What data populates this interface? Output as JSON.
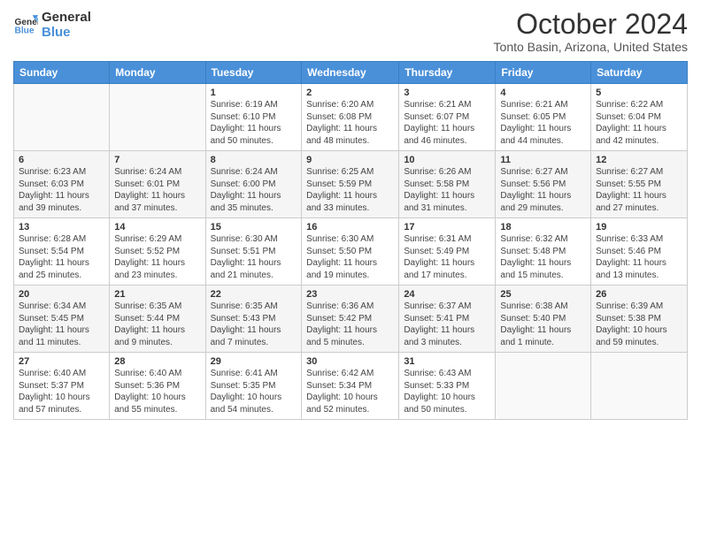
{
  "logo": {
    "line1": "General",
    "line2": "Blue"
  },
  "title": "October 2024",
  "subtitle": "Tonto Basin, Arizona, United States",
  "days_of_week": [
    "Sunday",
    "Monday",
    "Tuesday",
    "Wednesday",
    "Thursday",
    "Friday",
    "Saturday"
  ],
  "weeks": [
    [
      {
        "day": "",
        "info": ""
      },
      {
        "day": "",
        "info": ""
      },
      {
        "day": "1",
        "info": "Sunrise: 6:19 AM\nSunset: 6:10 PM\nDaylight: 11 hours and 50 minutes."
      },
      {
        "day": "2",
        "info": "Sunrise: 6:20 AM\nSunset: 6:08 PM\nDaylight: 11 hours and 48 minutes."
      },
      {
        "day": "3",
        "info": "Sunrise: 6:21 AM\nSunset: 6:07 PM\nDaylight: 11 hours and 46 minutes."
      },
      {
        "day": "4",
        "info": "Sunrise: 6:21 AM\nSunset: 6:05 PM\nDaylight: 11 hours and 44 minutes."
      },
      {
        "day": "5",
        "info": "Sunrise: 6:22 AM\nSunset: 6:04 PM\nDaylight: 11 hours and 42 minutes."
      }
    ],
    [
      {
        "day": "6",
        "info": "Sunrise: 6:23 AM\nSunset: 6:03 PM\nDaylight: 11 hours and 39 minutes."
      },
      {
        "day": "7",
        "info": "Sunrise: 6:24 AM\nSunset: 6:01 PM\nDaylight: 11 hours and 37 minutes."
      },
      {
        "day": "8",
        "info": "Sunrise: 6:24 AM\nSunset: 6:00 PM\nDaylight: 11 hours and 35 minutes."
      },
      {
        "day": "9",
        "info": "Sunrise: 6:25 AM\nSunset: 5:59 PM\nDaylight: 11 hours and 33 minutes."
      },
      {
        "day": "10",
        "info": "Sunrise: 6:26 AM\nSunset: 5:58 PM\nDaylight: 11 hours and 31 minutes."
      },
      {
        "day": "11",
        "info": "Sunrise: 6:27 AM\nSunset: 5:56 PM\nDaylight: 11 hours and 29 minutes."
      },
      {
        "day": "12",
        "info": "Sunrise: 6:27 AM\nSunset: 5:55 PM\nDaylight: 11 hours and 27 minutes."
      }
    ],
    [
      {
        "day": "13",
        "info": "Sunrise: 6:28 AM\nSunset: 5:54 PM\nDaylight: 11 hours and 25 minutes."
      },
      {
        "day": "14",
        "info": "Sunrise: 6:29 AM\nSunset: 5:52 PM\nDaylight: 11 hours and 23 minutes."
      },
      {
        "day": "15",
        "info": "Sunrise: 6:30 AM\nSunset: 5:51 PM\nDaylight: 11 hours and 21 minutes."
      },
      {
        "day": "16",
        "info": "Sunrise: 6:30 AM\nSunset: 5:50 PM\nDaylight: 11 hours and 19 minutes."
      },
      {
        "day": "17",
        "info": "Sunrise: 6:31 AM\nSunset: 5:49 PM\nDaylight: 11 hours and 17 minutes."
      },
      {
        "day": "18",
        "info": "Sunrise: 6:32 AM\nSunset: 5:48 PM\nDaylight: 11 hours and 15 minutes."
      },
      {
        "day": "19",
        "info": "Sunrise: 6:33 AM\nSunset: 5:46 PM\nDaylight: 11 hours and 13 minutes."
      }
    ],
    [
      {
        "day": "20",
        "info": "Sunrise: 6:34 AM\nSunset: 5:45 PM\nDaylight: 11 hours and 11 minutes."
      },
      {
        "day": "21",
        "info": "Sunrise: 6:35 AM\nSunset: 5:44 PM\nDaylight: 11 hours and 9 minutes."
      },
      {
        "day": "22",
        "info": "Sunrise: 6:35 AM\nSunset: 5:43 PM\nDaylight: 11 hours and 7 minutes."
      },
      {
        "day": "23",
        "info": "Sunrise: 6:36 AM\nSunset: 5:42 PM\nDaylight: 11 hours and 5 minutes."
      },
      {
        "day": "24",
        "info": "Sunrise: 6:37 AM\nSunset: 5:41 PM\nDaylight: 11 hours and 3 minutes."
      },
      {
        "day": "25",
        "info": "Sunrise: 6:38 AM\nSunset: 5:40 PM\nDaylight: 11 hours and 1 minute."
      },
      {
        "day": "26",
        "info": "Sunrise: 6:39 AM\nSunset: 5:38 PM\nDaylight: 10 hours and 59 minutes."
      }
    ],
    [
      {
        "day": "27",
        "info": "Sunrise: 6:40 AM\nSunset: 5:37 PM\nDaylight: 10 hours and 57 minutes."
      },
      {
        "day": "28",
        "info": "Sunrise: 6:40 AM\nSunset: 5:36 PM\nDaylight: 10 hours and 55 minutes."
      },
      {
        "day": "29",
        "info": "Sunrise: 6:41 AM\nSunset: 5:35 PM\nDaylight: 10 hours and 54 minutes."
      },
      {
        "day": "30",
        "info": "Sunrise: 6:42 AM\nSunset: 5:34 PM\nDaylight: 10 hours and 52 minutes."
      },
      {
        "day": "31",
        "info": "Sunrise: 6:43 AM\nSunset: 5:33 PM\nDaylight: 10 hours and 50 minutes."
      },
      {
        "day": "",
        "info": ""
      },
      {
        "day": "",
        "info": ""
      }
    ]
  ]
}
